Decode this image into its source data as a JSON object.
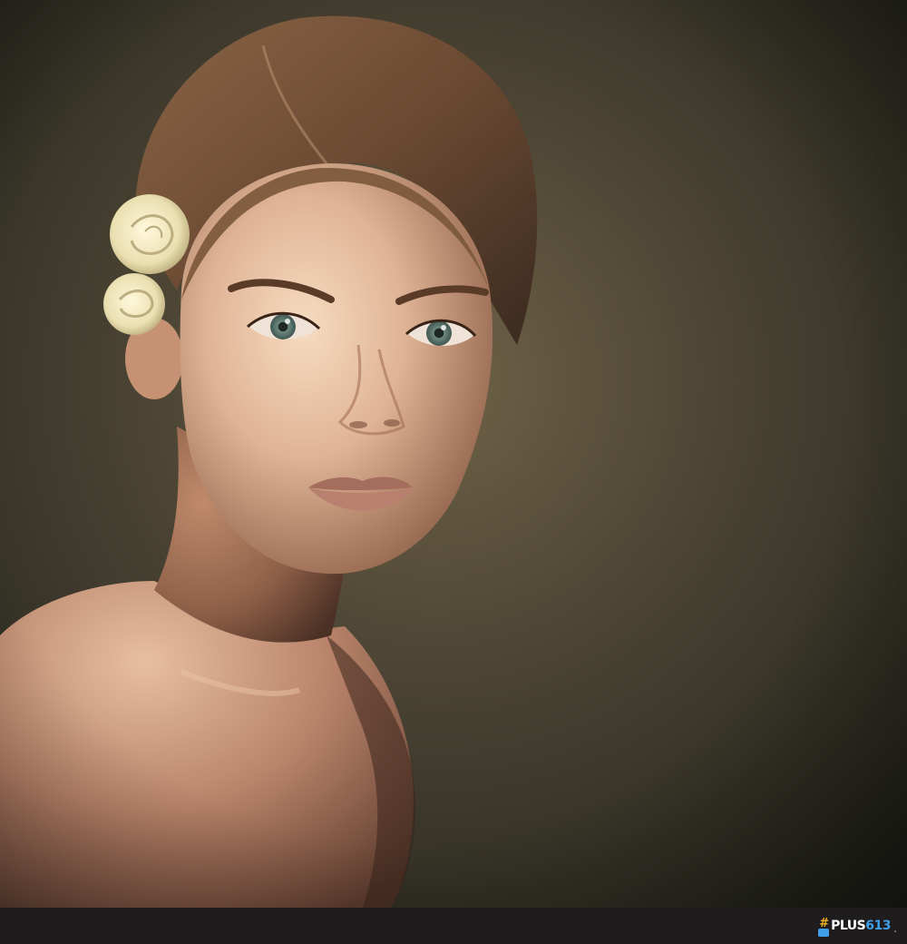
{
  "image": {
    "subject": "portrait",
    "colors": {
      "background_center": "#6f6247",
      "background_edge": "#1f2019",
      "skin_light": "#f3d2b5",
      "skin_mid": "#c79174",
      "skin_shadow": "#6e4735",
      "hair": "#6b4a33",
      "flower": "#f3ecc6",
      "eyes": "#5f7a72",
      "footer": "#1e1c1d"
    }
  },
  "watermark": {
    "hash": "#",
    "main": "PLUS",
    "accent": "613",
    "hash_color": "#f2b521",
    "accent_color": "#3f9fe8"
  }
}
